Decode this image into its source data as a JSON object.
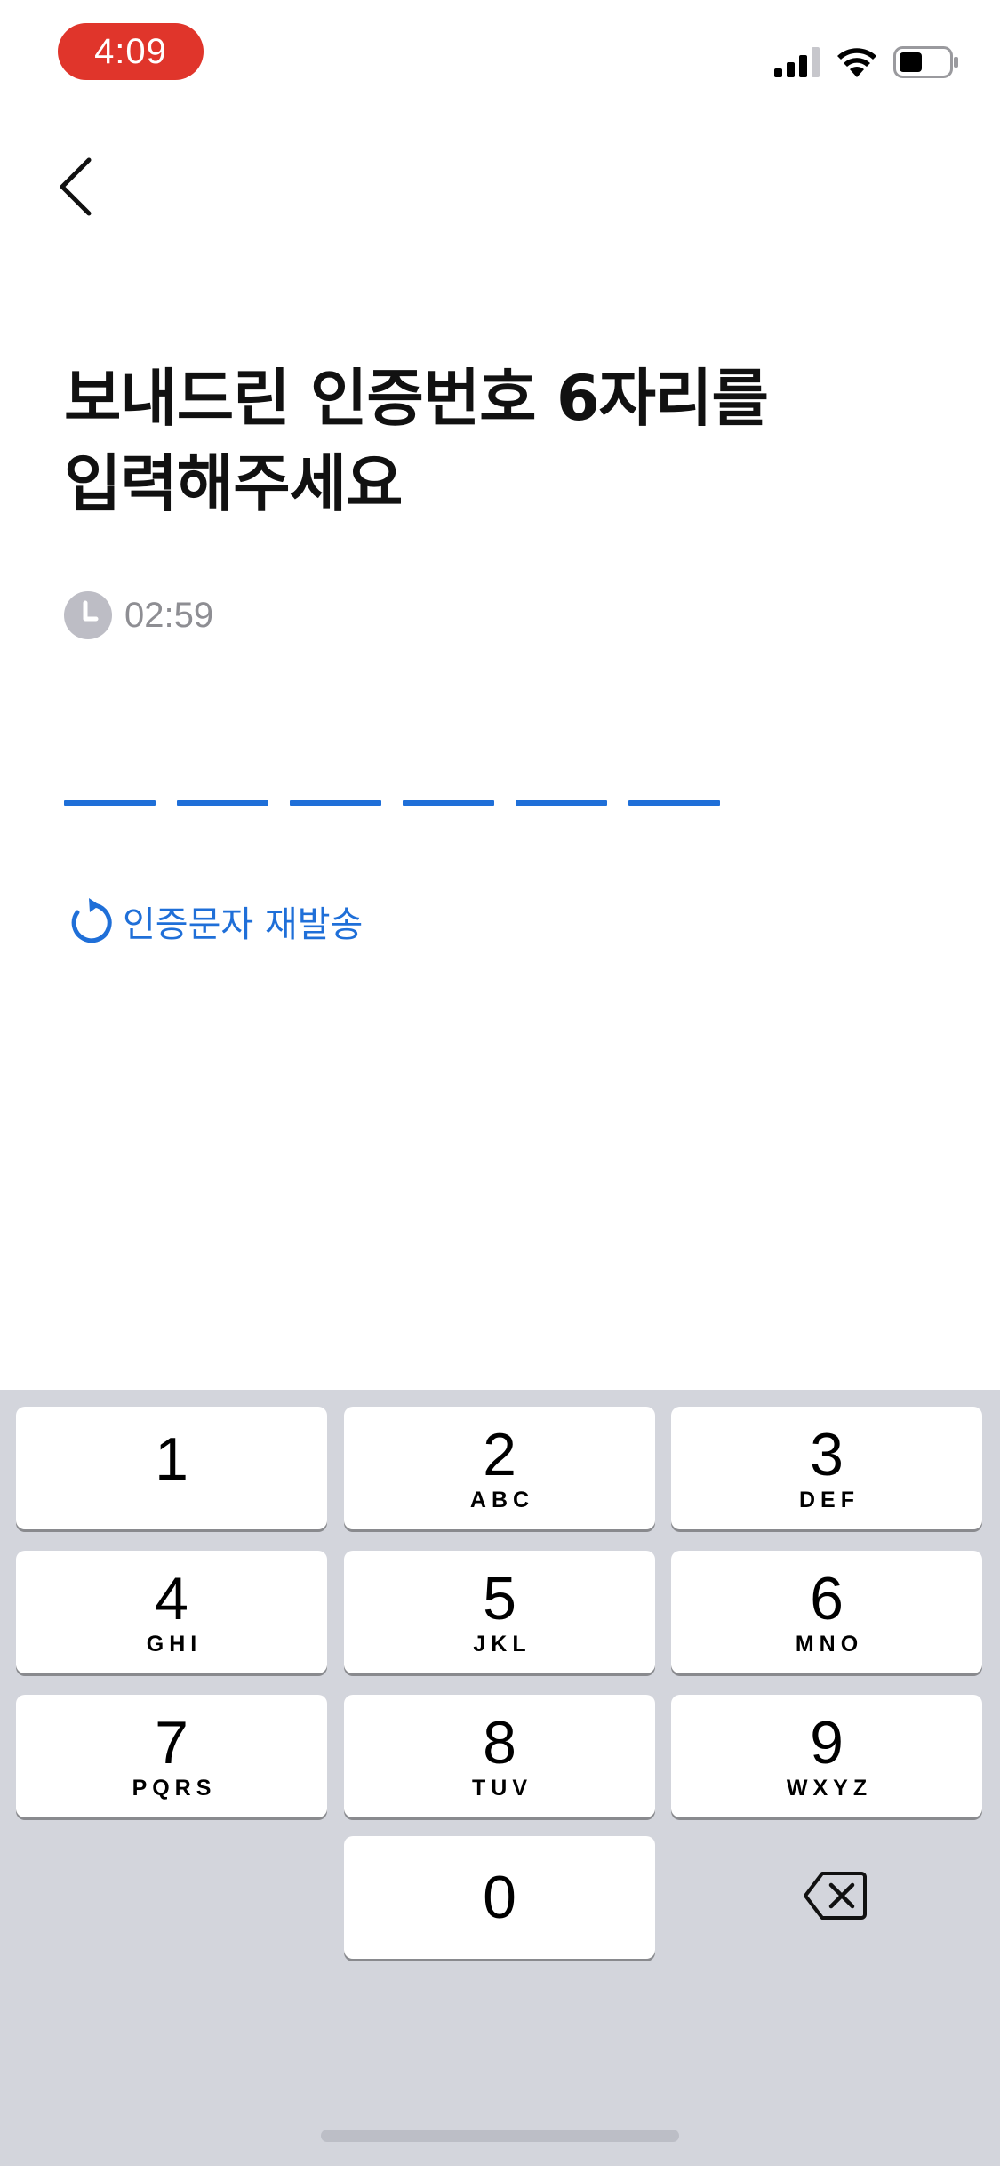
{
  "status_bar": {
    "time": "4:09",
    "icons": [
      "cellular-signal-icon",
      "wifi-icon",
      "battery-icon"
    ],
    "time_pill_color": "#e0352b"
  },
  "nav": {
    "back_icon": "chevron-left-icon"
  },
  "title": {
    "line1": "보내드린 인증번호 6자리를",
    "line2": "입력해주세요"
  },
  "timer": {
    "icon": "clock-icon",
    "value": "02:59"
  },
  "code_input": {
    "length": 6,
    "underline_color": "#1f6fd8"
  },
  "resend": {
    "icon": "refresh-icon",
    "label": "인증문자 재발송",
    "color": "#1f6fd8"
  },
  "keypad": {
    "keys": [
      {
        "digit": "1",
        "letters": ""
      },
      {
        "digit": "2",
        "letters": "ABC"
      },
      {
        "digit": "3",
        "letters": "DEF"
      },
      {
        "digit": "4",
        "letters": "GHI"
      },
      {
        "digit": "5",
        "letters": "JKL"
      },
      {
        "digit": "6",
        "letters": "MNO"
      },
      {
        "digit": "7",
        "letters": "PQRS"
      },
      {
        "digit": "8",
        "letters": "TUV"
      },
      {
        "digit": "9",
        "letters": "WXYZ"
      },
      {
        "digit": "0",
        "letters": ""
      }
    ],
    "backspace_icon": "backspace-icon"
  }
}
